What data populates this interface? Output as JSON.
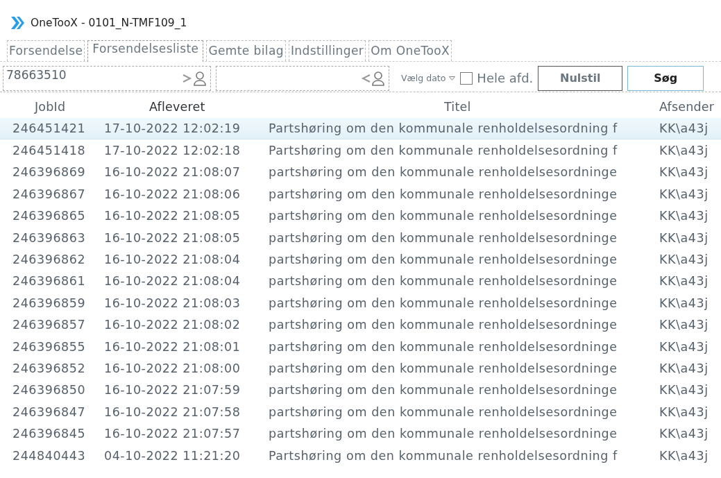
{
  "window": {
    "title": "OneTooX - 0101_N-TMF109_1"
  },
  "tabs": [
    {
      "label": "Forsendelse",
      "selected": false
    },
    {
      "label": "Forsendelsesliste",
      "selected": true
    },
    {
      "label": "Gemte bilag",
      "selected": false
    },
    {
      "label": "Indstillinger",
      "selected": false
    },
    {
      "label": "Om OneTooX",
      "selected": false
    }
  ],
  "toolbar": {
    "fields": [
      {
        "kind": "right",
        "value": "78663510"
      },
      {
        "kind": "left"
      }
    ],
    "date_picker": {
      "label": "Vælg dato"
    },
    "checkbox": {
      "label": "Hele afd.",
      "checked": false
    },
    "buttons": [
      {
        "label": "Nulstil",
        "default": false
      },
      {
        "label": "Søg",
        "default": true
      }
    ]
  },
  "table": {
    "columns": [
      "JobId",
      "Afleveret",
      "Titel",
      "Afsender"
    ],
    "rows": [
      {
        "cells": [
          "246451421",
          "17-10-2022 12:02:19",
          "Partshøring om den kommunale renholdelsesordning f",
          "KK\\a43j"
        ],
        "selected": true
      },
      {
        "cells": [
          "246451418",
          "17-10-2022 12:02:18",
          "Partshøring om den kommunale renholdelsesordning f",
          "KK\\a43j"
        ],
        "selected": false
      },
      {
        "cells": [
          "246396869",
          "16-10-2022 21:08:07",
          "partshøring om den kommunale renholdelsesordninge",
          "KK\\a43j"
        ],
        "selected": false
      },
      {
        "cells": [
          "246396867",
          "16-10-2022 21:08:06",
          "partshøring om den kommunale renholdelsesordninge",
          "KK\\a43j"
        ],
        "selected": false
      },
      {
        "cells": [
          "246396865",
          "16-10-2022 21:08:05",
          "partshøring om den kommunale renholdelsesordninge",
          "KK\\a43j"
        ],
        "selected": false
      },
      {
        "cells": [
          "246396863",
          "16-10-2022 21:08:05",
          "partshøring om den kommunale renholdelsesordninge",
          "KK\\a43j"
        ],
        "selected": false
      },
      {
        "cells": [
          "246396862",
          "16-10-2022 21:08:04",
          "partshøring om den kommunale renholdelsesordninge",
          "KK\\a43j"
        ],
        "selected": false
      },
      {
        "cells": [
          "246396861",
          "16-10-2022 21:08:04",
          "partshøring om den kommunale renholdelsesordninge",
          "KK\\a43j"
        ],
        "selected": false
      },
      {
        "cells": [
          "246396859",
          "16-10-2022 21:08:03",
          "partshøring om den kommunale renholdelsesordninge",
          "KK\\a43j"
        ],
        "selected": false
      },
      {
        "cells": [
          "246396857",
          "16-10-2022 21:08:02",
          "partshøring om den kommunale renholdelsesordninge",
          "KK\\a43j"
        ],
        "selected": false
      },
      {
        "cells": [
          "246396855",
          "16-10-2022 21:08:01",
          "partshøring om den kommunale renholdelsesordninge",
          "KK\\a43j"
        ],
        "selected": false
      },
      {
        "cells": [
          "246396852",
          "16-10-2022 21:08:00",
          "partshøring om den kommunale renholdelsesordninge",
          "KK\\a43j"
        ],
        "selected": false
      },
      {
        "cells": [
          "246396850",
          "16-10-2022 21:07:59",
          "partshøring om den kommunale renholdelsesordninge",
          "KK\\a43j"
        ],
        "selected": false
      },
      {
        "cells": [
          "246396847",
          "16-10-2022 21:07:58",
          "partshøring om den kommunale renholdelsesordninge",
          "KK\\a43j"
        ],
        "selected": false
      },
      {
        "cells": [
          "246396845",
          "16-10-2022 21:07:57",
          "partshøring om den kommunale renholdelsesordninge",
          "KK\\a43j"
        ],
        "selected": false
      },
      {
        "cells": [
          "244840443",
          "04-10-2022 11:21:20",
          "Partshøring om den kommunale renholdelsesordning f",
          "KK\\a43j"
        ],
        "selected": false
      }
    ]
  }
}
